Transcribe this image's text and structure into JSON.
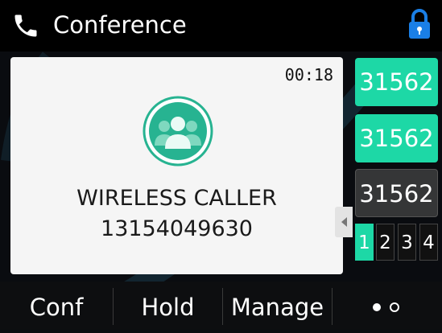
{
  "header": {
    "title": "Conference",
    "call_icon": "phone-icon",
    "lock_icon": "lock-icon"
  },
  "call": {
    "duration": "00:18",
    "avatar_icon": "group-avatar-icon",
    "caller_name": "WIRELESS CALLER",
    "caller_number": "13154049630"
  },
  "line_keys": [
    {
      "label": "31562",
      "state": "active"
    },
    {
      "label": "31562",
      "state": "active"
    },
    {
      "label": "31562",
      "state": "inactive"
    }
  ],
  "pages": {
    "items": [
      "1",
      "2",
      "3",
      "4"
    ],
    "current": "1"
  },
  "softkeys": {
    "conf": "Conf",
    "hold": "Hold",
    "manage": "Manage",
    "more_icon": "more-dots-icon"
  },
  "colors": {
    "accent": "#1dd8a6",
    "lock": "#1a7fe6",
    "background": "#0a0c10"
  }
}
